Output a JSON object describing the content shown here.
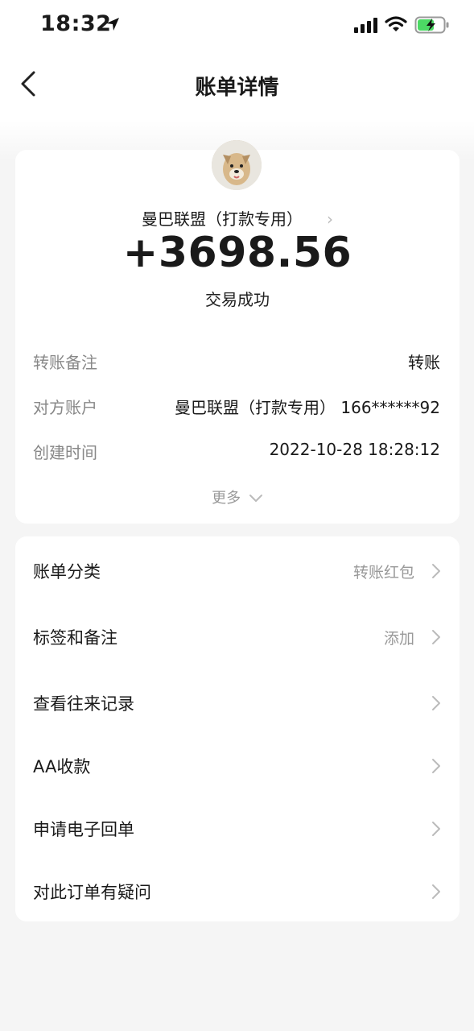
{
  "status_bar": {
    "time": "18:32"
  },
  "nav": {
    "title": "账单详情"
  },
  "transaction": {
    "payee": "曼巴联盟（打款专用）",
    "amount": "+3698.56",
    "status": "交易成功"
  },
  "details": [
    {
      "label": "转账备注",
      "value": "转账"
    },
    {
      "label": "对方账户",
      "value": "曼巴联盟（打款专用） 166******92"
    },
    {
      "label": "创建时间",
      "value": "2022-10-28 18:28:12"
    }
  ],
  "more_label": "更多",
  "list": [
    {
      "label": "账单分类",
      "value": "转账红包"
    },
    {
      "label": "标签和备注",
      "value": "添加"
    },
    {
      "label": "查看往来记录",
      "value": ""
    },
    {
      "label": "AA收款",
      "value": ""
    },
    {
      "label": "申请电子回单",
      "value": ""
    },
    {
      "label": "对此订单有疑问",
      "value": ""
    }
  ]
}
